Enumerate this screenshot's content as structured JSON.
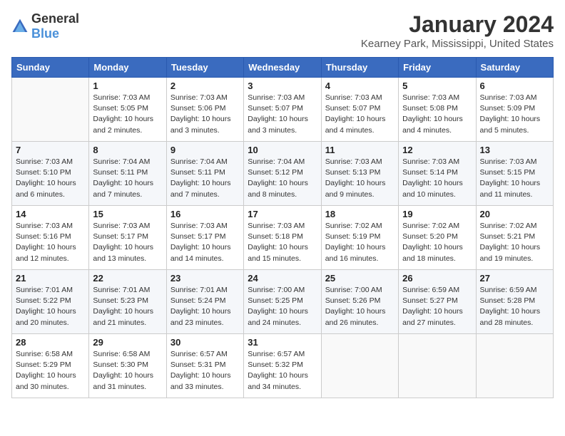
{
  "logo": {
    "general": "General",
    "blue": "Blue"
  },
  "title": "January 2024",
  "subtitle": "Kearney Park, Mississippi, United States",
  "days_of_week": [
    "Sunday",
    "Monday",
    "Tuesday",
    "Wednesday",
    "Thursday",
    "Friday",
    "Saturday"
  ],
  "weeks": [
    [
      {
        "day": "",
        "info": ""
      },
      {
        "day": "1",
        "info": "Sunrise: 7:03 AM\nSunset: 5:05 PM\nDaylight: 10 hours\nand 2 minutes."
      },
      {
        "day": "2",
        "info": "Sunrise: 7:03 AM\nSunset: 5:06 PM\nDaylight: 10 hours\nand 3 minutes."
      },
      {
        "day": "3",
        "info": "Sunrise: 7:03 AM\nSunset: 5:07 PM\nDaylight: 10 hours\nand 3 minutes."
      },
      {
        "day": "4",
        "info": "Sunrise: 7:03 AM\nSunset: 5:07 PM\nDaylight: 10 hours\nand 4 minutes."
      },
      {
        "day": "5",
        "info": "Sunrise: 7:03 AM\nSunset: 5:08 PM\nDaylight: 10 hours\nand 4 minutes."
      },
      {
        "day": "6",
        "info": "Sunrise: 7:03 AM\nSunset: 5:09 PM\nDaylight: 10 hours\nand 5 minutes."
      }
    ],
    [
      {
        "day": "7",
        "info": "Sunrise: 7:03 AM\nSunset: 5:10 PM\nDaylight: 10 hours\nand 6 minutes."
      },
      {
        "day": "8",
        "info": "Sunrise: 7:04 AM\nSunset: 5:11 PM\nDaylight: 10 hours\nand 7 minutes."
      },
      {
        "day": "9",
        "info": "Sunrise: 7:04 AM\nSunset: 5:11 PM\nDaylight: 10 hours\nand 7 minutes."
      },
      {
        "day": "10",
        "info": "Sunrise: 7:04 AM\nSunset: 5:12 PM\nDaylight: 10 hours\nand 8 minutes."
      },
      {
        "day": "11",
        "info": "Sunrise: 7:03 AM\nSunset: 5:13 PM\nDaylight: 10 hours\nand 9 minutes."
      },
      {
        "day": "12",
        "info": "Sunrise: 7:03 AM\nSunset: 5:14 PM\nDaylight: 10 hours\nand 10 minutes."
      },
      {
        "day": "13",
        "info": "Sunrise: 7:03 AM\nSunset: 5:15 PM\nDaylight: 10 hours\nand 11 minutes."
      }
    ],
    [
      {
        "day": "14",
        "info": "Sunrise: 7:03 AM\nSunset: 5:16 PM\nDaylight: 10 hours\nand 12 minutes."
      },
      {
        "day": "15",
        "info": "Sunrise: 7:03 AM\nSunset: 5:17 PM\nDaylight: 10 hours\nand 13 minutes."
      },
      {
        "day": "16",
        "info": "Sunrise: 7:03 AM\nSunset: 5:17 PM\nDaylight: 10 hours\nand 14 minutes."
      },
      {
        "day": "17",
        "info": "Sunrise: 7:03 AM\nSunset: 5:18 PM\nDaylight: 10 hours\nand 15 minutes."
      },
      {
        "day": "18",
        "info": "Sunrise: 7:02 AM\nSunset: 5:19 PM\nDaylight: 10 hours\nand 16 minutes."
      },
      {
        "day": "19",
        "info": "Sunrise: 7:02 AM\nSunset: 5:20 PM\nDaylight: 10 hours\nand 18 minutes."
      },
      {
        "day": "20",
        "info": "Sunrise: 7:02 AM\nSunset: 5:21 PM\nDaylight: 10 hours\nand 19 minutes."
      }
    ],
    [
      {
        "day": "21",
        "info": "Sunrise: 7:01 AM\nSunset: 5:22 PM\nDaylight: 10 hours\nand 20 minutes."
      },
      {
        "day": "22",
        "info": "Sunrise: 7:01 AM\nSunset: 5:23 PM\nDaylight: 10 hours\nand 21 minutes."
      },
      {
        "day": "23",
        "info": "Sunrise: 7:01 AM\nSunset: 5:24 PM\nDaylight: 10 hours\nand 23 minutes."
      },
      {
        "day": "24",
        "info": "Sunrise: 7:00 AM\nSunset: 5:25 PM\nDaylight: 10 hours\nand 24 minutes."
      },
      {
        "day": "25",
        "info": "Sunrise: 7:00 AM\nSunset: 5:26 PM\nDaylight: 10 hours\nand 26 minutes."
      },
      {
        "day": "26",
        "info": "Sunrise: 6:59 AM\nSunset: 5:27 PM\nDaylight: 10 hours\nand 27 minutes."
      },
      {
        "day": "27",
        "info": "Sunrise: 6:59 AM\nSunset: 5:28 PM\nDaylight: 10 hours\nand 28 minutes."
      }
    ],
    [
      {
        "day": "28",
        "info": "Sunrise: 6:58 AM\nSunset: 5:29 PM\nDaylight: 10 hours\nand 30 minutes."
      },
      {
        "day": "29",
        "info": "Sunrise: 6:58 AM\nSunset: 5:30 PM\nDaylight: 10 hours\nand 31 minutes."
      },
      {
        "day": "30",
        "info": "Sunrise: 6:57 AM\nSunset: 5:31 PM\nDaylight: 10 hours\nand 33 minutes."
      },
      {
        "day": "31",
        "info": "Sunrise: 6:57 AM\nSunset: 5:32 PM\nDaylight: 10 hours\nand 34 minutes."
      },
      {
        "day": "",
        "info": ""
      },
      {
        "day": "",
        "info": ""
      },
      {
        "day": "",
        "info": ""
      }
    ]
  ]
}
